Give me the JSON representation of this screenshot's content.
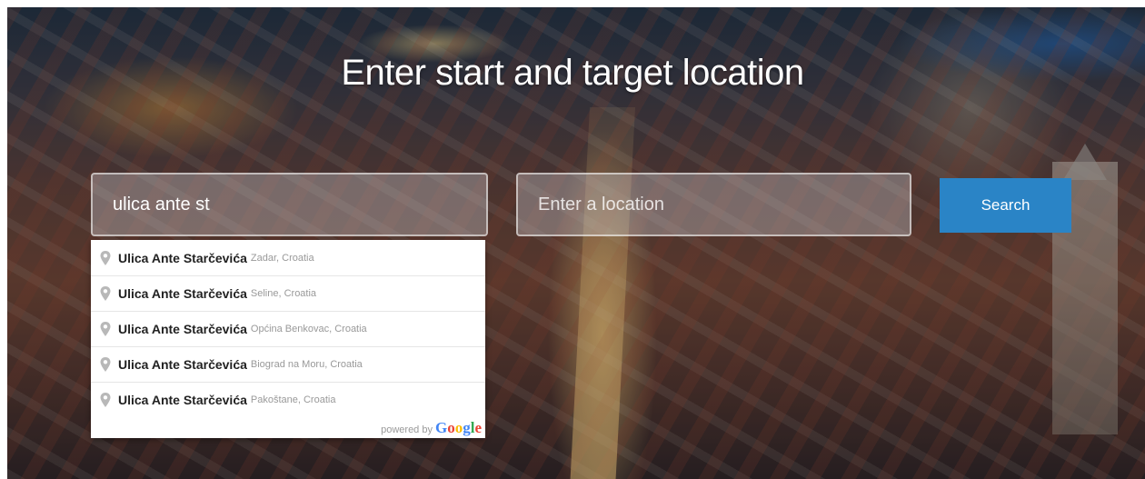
{
  "hero": {
    "title": "Enter start and target location"
  },
  "form": {
    "start_value": "ulica ante st",
    "target_placeholder": "Enter a location",
    "search_label": "Search"
  },
  "autocomplete": {
    "items": [
      {
        "main": "Ulica Ante Starčevića",
        "secondary": "Zadar, Croatia"
      },
      {
        "main": "Ulica Ante Starčevića",
        "secondary": "Seline, Croatia"
      },
      {
        "main": "Ulica Ante Starčevića",
        "secondary": "Općina Benkovac, Croatia"
      },
      {
        "main": "Ulica Ante Starčevića",
        "secondary": "Biograd na Moru, Croatia"
      },
      {
        "main": "Ulica Ante Starčevića",
        "secondary": "Pakoštane, Croatia"
      }
    ],
    "powered_by": "powered by",
    "google_logo": "Google",
    "pin_icon": "map-pin-icon"
  },
  "colors": {
    "button": "#2a84c6",
    "google_letters": [
      "#4285f4",
      "#ea4335",
      "#fbbc05",
      "#4285f4",
      "#34a853",
      "#ea4335"
    ]
  }
}
